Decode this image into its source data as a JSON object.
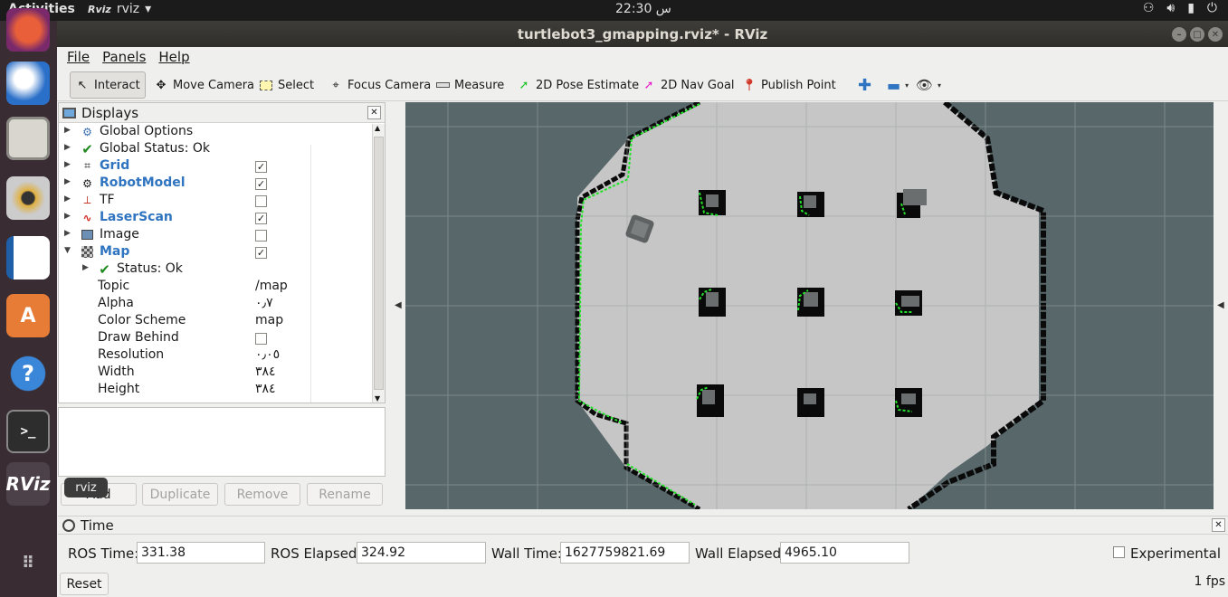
{
  "topbar": {
    "activities": "Activities",
    "app_name": "rviz",
    "app_icon": "Rviz",
    "clock": "22:30 س",
    "tray_icons": [
      "network-icon",
      "volume-icon",
      "battery-icon",
      "power-icon"
    ]
  },
  "window": {
    "title": "turtlebot3_gmapping.rviz* - RViz"
  },
  "dock": {
    "tooltip": "rviz",
    "rviz_label": "RViz"
  },
  "menu": {
    "file": "File",
    "panels": "Panels",
    "help": "Help"
  },
  "toolbar": {
    "interact": "Interact",
    "move_camera": "Move Camera",
    "select": "Select",
    "focus_camera": "Focus Camera",
    "measure": "Measure",
    "pose_estimate": "2D Pose Estimate",
    "nav_goal": "2D Nav Goal",
    "publish_point": "Publish Point"
  },
  "displays": {
    "title": "Displays",
    "items": [
      {
        "label": "Global Options"
      },
      {
        "label": "Global Status: Ok"
      },
      {
        "label": "Grid",
        "checked": true
      },
      {
        "label": "RobotModel",
        "checked": true
      },
      {
        "label": "TF",
        "checked": false
      },
      {
        "label": "LaserScan",
        "checked": true
      },
      {
        "label": "Image",
        "checked": false
      },
      {
        "label": "Map",
        "checked": true
      }
    ],
    "map_props": {
      "status": "Status: Ok",
      "topic_label": "Topic",
      "topic_value": "/map",
      "alpha_label": "Alpha",
      "alpha_value": "٠٫٧",
      "color_scheme_label": "Color Scheme",
      "color_scheme_value": "map",
      "draw_behind_label": "Draw Behind",
      "draw_behind_checked": false,
      "resolution_label": "Resolution",
      "resolution_value": "٠٫٠٥",
      "width_label": "Width",
      "width_value": "٣٨٤",
      "height_label": "Height",
      "height_value": "٣٨٤"
    }
  },
  "buttons": {
    "add": "Add",
    "duplicate": "Duplicate",
    "remove": "Remove",
    "rename": "Rename"
  },
  "time": {
    "title": "Time",
    "ros_time_label": "ROS Time:",
    "ros_time": "331.38",
    "ros_elapsed_label": "ROS Elapsed:",
    "ros_elapsed": "324.92",
    "wall_time_label": "Wall Time:",
    "wall_time": "1627759821.69",
    "wall_elapsed_label": "Wall Elapsed:",
    "wall_elapsed": "4965.10",
    "experimental": "Experimental",
    "reset": "Reset",
    "fps": "1 fps"
  },
  "colors": {
    "map_free": "#c6c6c6",
    "map_unknown": "#58676a",
    "map_wall": "#0a0a0a",
    "laser": "#22e22a",
    "grid": "#9aa3a5"
  }
}
